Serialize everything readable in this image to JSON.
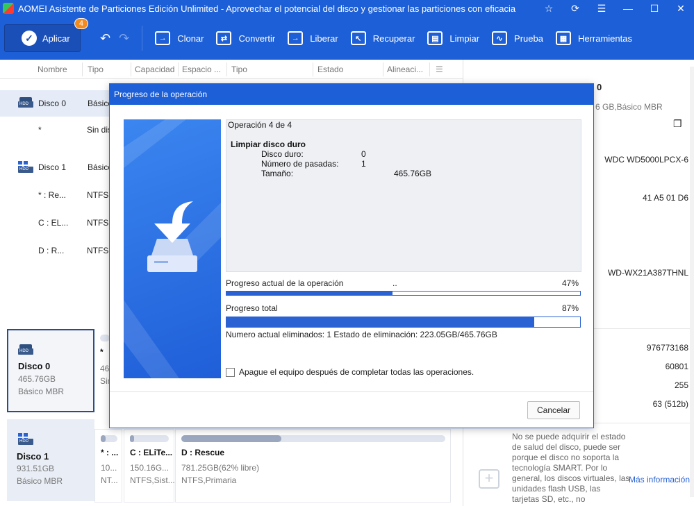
{
  "window": {
    "title": "AOMEI Asistente de Particiones Edición Unlimited - Aprovechar el potencial del disco y gestionar las particiones con eficacia"
  },
  "toolbar": {
    "apply_label": "Aplicar",
    "apply_badge": "4",
    "tools": [
      "Clonar",
      "Convertir",
      "Liberar",
      "Recuperar",
      "Limpiar",
      "Prueba",
      "Herramientas"
    ]
  },
  "table": {
    "columns": [
      "Nombre",
      "Tipo",
      "Capacidad",
      "Espacio ...",
      "Tipo",
      "Estado",
      "Alineaci..."
    ],
    "rows": [
      {
        "name": "Disco 0",
        "type": "Básico"
      },
      {
        "name": "*",
        "type": "Sin dis"
      },
      {
        "name": "Disco 1",
        "type": "Básico"
      },
      {
        "name": "* : Re...",
        "type": "NTFS"
      },
      {
        "name": "C : EL...",
        "type": "NTFS"
      },
      {
        "name": "D : R...",
        "type": "NTFS"
      }
    ]
  },
  "disk_map": {
    "disk0": {
      "name": "Disco 0",
      "size": "465.76GB",
      "kind": "Básico MBR",
      "part_name": "*",
      "part_size": "46",
      "part_type": "Sin"
    },
    "disk1": {
      "name": "Disco 1",
      "size": "931.51GB",
      "kind": "Básico MBR"
    },
    "disk1_parts": [
      {
        "name": "* : ...",
        "size": "10...",
        "type": "NT...",
        "fill": 0.3
      },
      {
        "name": "C : ELiTe...",
        "size": "150.16G...",
        "type": "NTFS,Sist...",
        "fill": 0.1
      },
      {
        "name": "D : Rescue",
        "size": "781.25GB(62% libre)",
        "type": "NTFS,Primaria",
        "fill": 0.38
      }
    ]
  },
  "right_panel": {
    "title_fragment": "0",
    "subtitle_fragment": "6 GB,Básico MBR",
    "model": "WDC WD5000LPCX-6",
    "signature": "41 A5 01 D6",
    "serial": "WD-WX21A387THNL",
    "sectors": "976773168",
    "cylinders": "60801",
    "heads": "255",
    "sector_size": "63 (512b)",
    "smart_note": "No se puede adquirir el estado de salud del disco, puede ser porque el disco no soporta la tecnología SMART. Por lo general, los discos virtuales, las unidades flash USB, las tarjetas SD, etc., no",
    "more_info": "Más información"
  },
  "dialog": {
    "title": "Progreso de la operación",
    "operation": "Operación 4 de 4",
    "op_name": "Limpiar disco duro",
    "fields": [
      {
        "label": "Disco duro:",
        "value": "0"
      },
      {
        "label": "Número de pasadas:",
        "value": "1"
      },
      {
        "label": "Tamaño:",
        "value": "465.76GB"
      }
    ],
    "current_label": "Progreso actual de la operación",
    "current_dots": "..",
    "current_pct": "47%",
    "current_value": 0.47,
    "total_label": "Progreso total",
    "total_pct": "87%",
    "total_value": 0.87,
    "status": "Numero actual eliminados: 1 Estado de eliminación: 223.05GB/465.76GB",
    "shutdown_label": "Apague el equipo después de completar todas las operaciones.",
    "cancel_label": "Cancelar"
  }
}
